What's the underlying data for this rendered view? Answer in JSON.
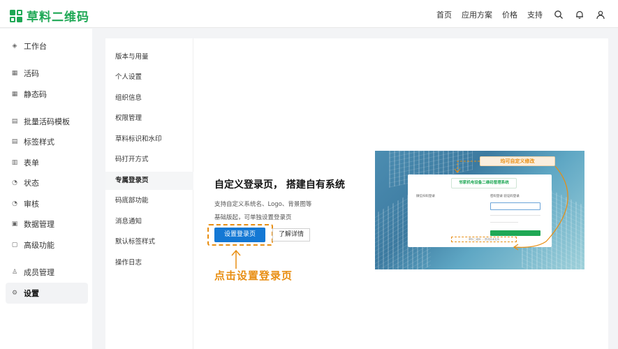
{
  "brand": {
    "name": "草料二维码"
  },
  "topnav": {
    "items": [
      "首页",
      "应用方案",
      "价格",
      "支持"
    ]
  },
  "sidebar": {
    "items": [
      {
        "label": "工作台",
        "icon": "box-icon"
      },
      {
        "label": "活码",
        "icon": "grid-icon"
      },
      {
        "label": "静态码",
        "icon": "grid-icon"
      },
      {
        "label": "批量活码模板",
        "icon": "template-icon"
      },
      {
        "label": "标签样式",
        "icon": "label-icon"
      },
      {
        "label": "表单",
        "icon": "form-icon"
      },
      {
        "label": "状态",
        "icon": "clock-icon"
      },
      {
        "label": "审核",
        "icon": "clock-icon"
      },
      {
        "label": "数据管理",
        "icon": "data-icon"
      },
      {
        "label": "高级功能",
        "icon": "lock-icon"
      },
      {
        "label": "成员管理",
        "icon": "user-icon"
      },
      {
        "label": "设置",
        "icon": "gear-icon"
      }
    ],
    "active": "设置"
  },
  "subnav": {
    "items": [
      "版本与用量",
      "个人设置",
      "组织信息",
      "权限管理",
      "草料标识和水印",
      "码打开方式",
      "专属登录页",
      "码底部功能",
      "消息通知",
      "默认标签样式",
      "操作日志"
    ],
    "active": "专属登录页"
  },
  "content": {
    "headline": "自定义登录页， 搭建自有系统",
    "desc1": "支持自定义系统名、Logo、背景图等",
    "desc2": "基础版起，可单独设置登录页",
    "primary_button": "设置登录页",
    "secondary_button": "了解详情",
    "callout": "点击设置登录页"
  },
  "preview": {
    "editable_tag": "均可自定义修改",
    "system_title": "邻家机电设备二维码管理系统",
    "left_heading": "微信扫码登录",
    "right_tabs": "密码登录   验证码登录",
    "footer": "草料二维码 ... 提供技术支持"
  },
  "colors": {
    "brand_green": "#1fa855",
    "primary_blue": "#1478d4",
    "accent_orange": "#e88e12"
  }
}
